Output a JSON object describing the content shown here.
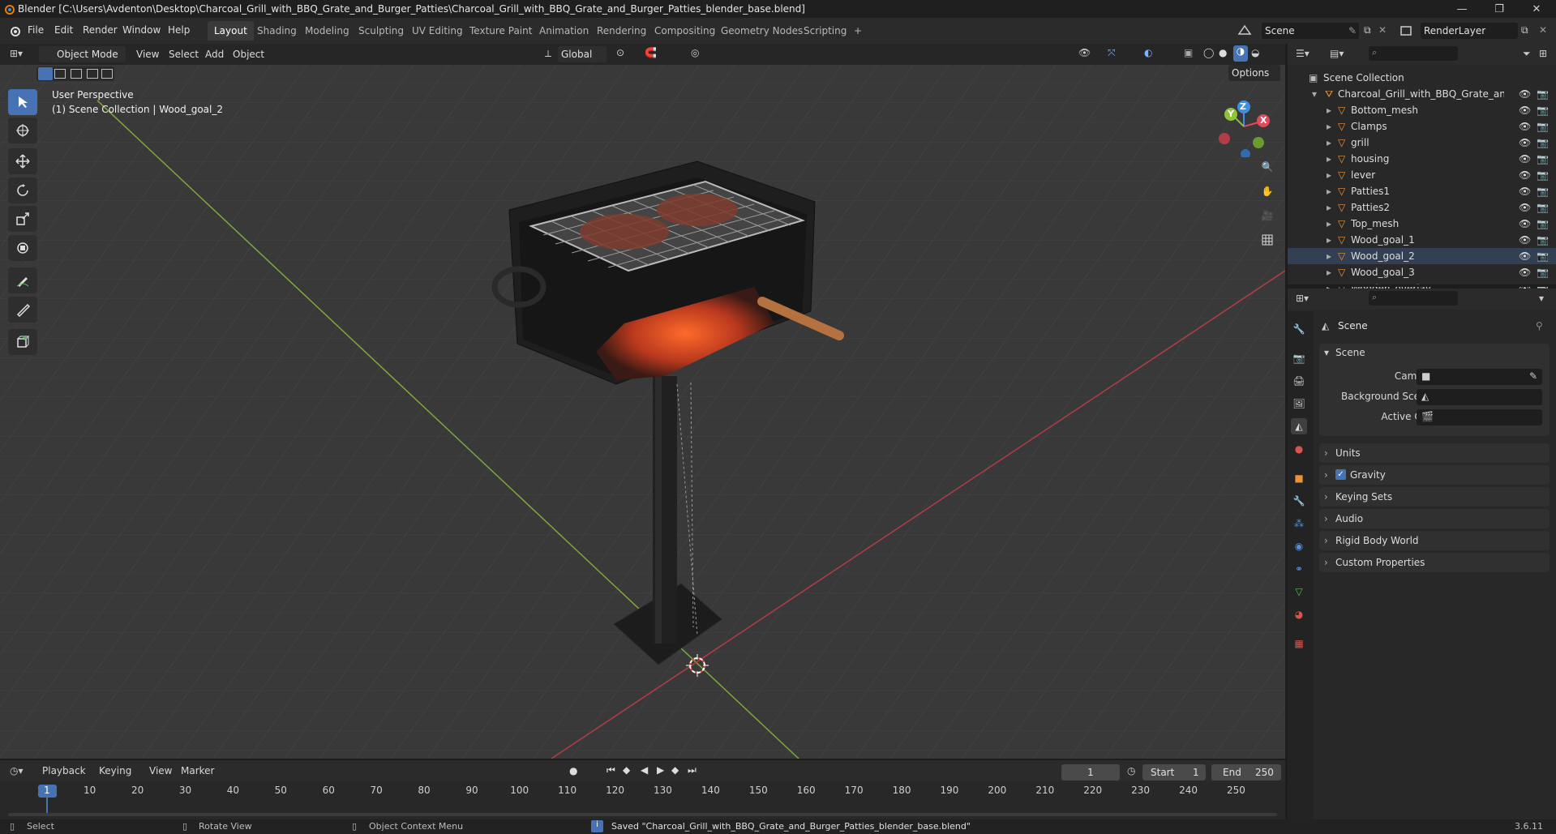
{
  "window": {
    "title": "Blender [C:\\Users\\Avdenton\\Desktop\\Charcoal_Grill_with_BBQ_Grate_and_Burger_Patties\\Charcoal_Grill_with_BBQ_Grate_and_Burger_Patties_blender_base.blend]",
    "minimize": "—",
    "maximize": "❐",
    "close": "✕"
  },
  "menu": {
    "file": "File",
    "edit": "Edit",
    "render": "Render",
    "window": "Window",
    "help": "Help"
  },
  "workspaces": [
    "Layout",
    "Shading",
    "Modeling",
    "Sculpting",
    "UV Editing",
    "Texture Paint",
    "Animation",
    "Rendering",
    "Compositing",
    "Geometry Nodes",
    "Scripting"
  ],
  "workspace_add": "+",
  "scene_field": "Scene",
  "renderlayer_field": "RenderLayer",
  "viewport_header": {
    "mode": "Object Mode",
    "view": "View",
    "select": "Select",
    "add": "Add",
    "object": "Object",
    "orientation": "Global",
    "options": "Options"
  },
  "viewport_overlay": {
    "perspective": "User Perspective",
    "collection": "(1) Scene Collection | Wood_goal_2"
  },
  "gizmo": {
    "x": "X",
    "y": "Y",
    "z": "Z"
  },
  "outliner": {
    "root": "Scene Collection",
    "collection": "Charcoal_Grill_with_BBQ_Grate_and_Bu",
    "objects": [
      "Bottom_mesh",
      "Clamps",
      "grill",
      "housing",
      "lever",
      "Patties1",
      "Patties2",
      "Top_mesh",
      "Wood_goal_1",
      "Wood_goal_2",
      "Wood_goal_3",
      "Wooden_overlay"
    ]
  },
  "properties": {
    "context": "Scene",
    "section": "Scene",
    "camera_label": "Camera",
    "background_scene_label": "Background Scene",
    "active_clip_label": "Active Clip",
    "panels": [
      "Units",
      "Gravity",
      "Keying Sets",
      "Audio",
      "Rigid Body World",
      "Custom Properties"
    ]
  },
  "timeline": {
    "playback": "Playback",
    "keying": "Keying",
    "view": "View",
    "marker": "Marker",
    "current_frame": "1",
    "start_label": "Start",
    "start": "1",
    "end_label": "End",
    "end": "250",
    "ticks": [
      "1",
      "10",
      "20",
      "30",
      "40",
      "50",
      "60",
      "70",
      "80",
      "90",
      "100",
      "110",
      "120",
      "130",
      "140",
      "150",
      "160",
      "170",
      "180",
      "190",
      "200",
      "210",
      "220",
      "230",
      "240",
      "250"
    ]
  },
  "status": {
    "select": "Select",
    "rotate": "Rotate View",
    "context_menu": "Object Context Menu",
    "message": "Saved \"Charcoal_Grill_with_BBQ_Grate_and_Burger_Patties_blender_base.blend\"",
    "version": "3.6.11"
  },
  "colors": {
    "accent": "#4772b3",
    "x_axis": "#e04a5a",
    "y_axis": "#8cc43a",
    "z_axis": "#3d8fe0",
    "object_orange": "#e8943c"
  }
}
